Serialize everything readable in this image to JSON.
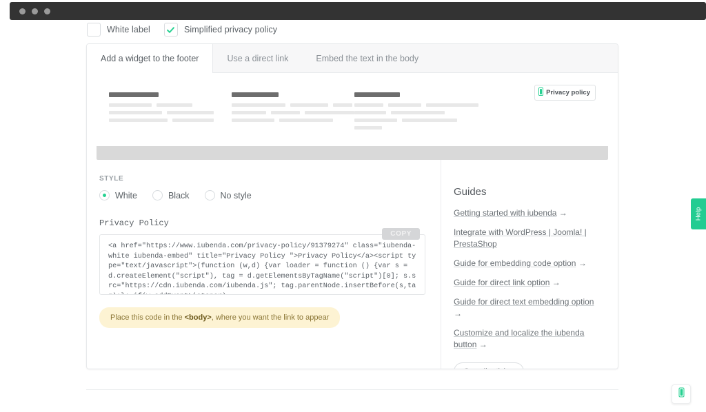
{
  "browser": {
    "dots": 3
  },
  "options": {
    "white_label": {
      "label": "White label",
      "checked": false,
      "icon": "checkbox-icon"
    },
    "simplified_privacy_policy": {
      "label": "Simplified privacy policy",
      "checked": true,
      "icon": "checkmark-icon"
    }
  },
  "tabs": [
    {
      "label": "Add a widget to the footer",
      "active": true
    },
    {
      "label": "Use a direct link",
      "active": false
    },
    {
      "label": "Embed the text in the body",
      "active": false
    }
  ],
  "preview": {
    "badge": {
      "label": "Privacy policy",
      "icon": "iubenda-shield-icon",
      "color": "#25d191"
    },
    "columns": [
      {
        "head_width": 72,
        "lines": [
          [
            62,
            52
          ],
          [
            77,
            68
          ],
          [
            85,
            60
          ]
        ]
      },
      {
        "head_width": 68,
        "lines": [
          [
            78,
            55,
            28
          ],
          [
            52,
            45,
            75
          ],
          [
            62,
            78
          ]
        ]
      },
      {
        "head_width": 66,
        "lines": [
          [
            48,
            56,
            88
          ],
          [
            46,
            78
          ],
          [
            62,
            80
          ],
          [
            40
          ]
        ]
      }
    ]
  },
  "style_section": {
    "label": "STYLE",
    "options": [
      {
        "label": "White",
        "selected": true
      },
      {
        "label": "Black",
        "selected": false
      },
      {
        "label": "No style",
        "selected": false
      }
    ],
    "accent": "#25d191"
  },
  "code_section": {
    "title": "Privacy Policy",
    "copy_label": "COPY",
    "code": "<a href=\"https://www.iubenda.com/privacy-policy/91379274\" class=\"iubenda-white iubenda-embed\" title=\"Privacy Policy \">Privacy Policy</a><script type=\"text/javascript\">(function (w,d) {var loader = function () {var s = d.createElement(\"script\"), tag = d.getElementsByTagName(\"script\")[0]; s.src=\"https://cdn.iubenda.com/iubenda.js\"; tag.parentNode.insertBefore(s,tag);}; if(w.addEventListener)"
  },
  "notice": {
    "prefix": "Place this code in the ",
    "code": "<body>",
    "suffix": ", where you want the link to appear",
    "background": "#fdf3d3"
  },
  "guides": {
    "title": "Guides",
    "items": [
      {
        "text": "Getting started with iubenda",
        "arrow": "→"
      },
      {
        "text": "Integrate with WordPress | Joomla! | PrestaShop",
        "arrow": ""
      },
      {
        "text": "Guide for embedding code option",
        "arrow": "→"
      },
      {
        "text": "Guide for direct link option",
        "arrow": "→"
      },
      {
        "text": "Guide for direct text embedding option",
        "arrow": "→"
      },
      {
        "text": "Customize and localize the iubenda button",
        "arrow": "→"
      }
    ],
    "see_all_label": "See all articles"
  },
  "help_tab": {
    "label": "Help",
    "color": "#23cc92"
  },
  "fab": {
    "icon": "iubenda-shield-icon",
    "color": "#25d191"
  }
}
